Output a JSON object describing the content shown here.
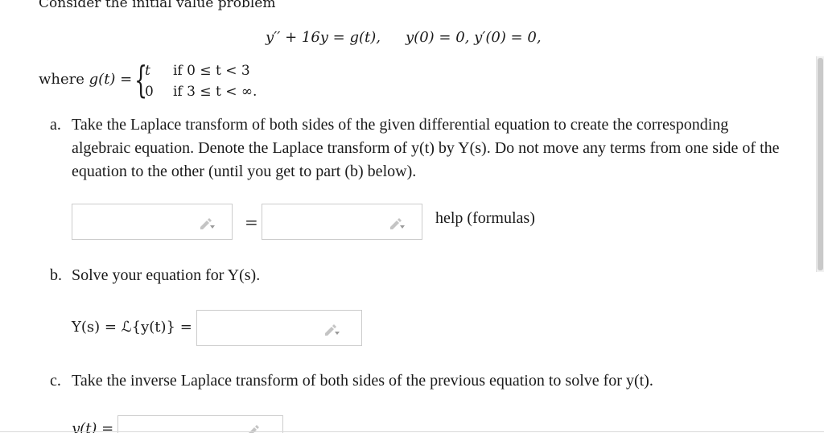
{
  "problem": {
    "intro": "Consider the initial value problem",
    "ode": "y′′ + 16y = g(t),",
    "initial_conditions": "y(0) = 0,   y′(0) = 0,",
    "where_label": "where",
    "g_def": "g(t) =",
    "piece1_value": "t",
    "piece1_condition": "if 0 ≤ t < 3",
    "piece2_value": "0",
    "piece2_condition": "if 3 ≤ t < ∞."
  },
  "part_a": {
    "marker": "a.",
    "text": "Take the Laplace transform of both sides of the given differential equation to create the corresponding algebraic equation. Denote the Laplace transform of y(t) by Y(s). Do not move any terms from one side of the equation to the other (until you get to part (b) below).",
    "left_input_value": "",
    "equals": "=",
    "right_input_value": "",
    "help_link": "help (formulas)"
  },
  "part_b": {
    "marker": "b.",
    "text": "Solve your equation for Y(s).",
    "label": "Y(s) = ℒ{y(t)} =",
    "input_value": ""
  },
  "part_c": {
    "marker": "c.",
    "text": "Take the inverse Laplace transform of both sides of the previous equation to solve for y(t).",
    "label": "y(t) =",
    "input_value": ""
  },
  "icons": {
    "edit": "pencil-icon"
  },
  "colors": {
    "text": "#1a1a1a",
    "input_border": "#cccccc",
    "pencil": "#bfbfbf"
  }
}
